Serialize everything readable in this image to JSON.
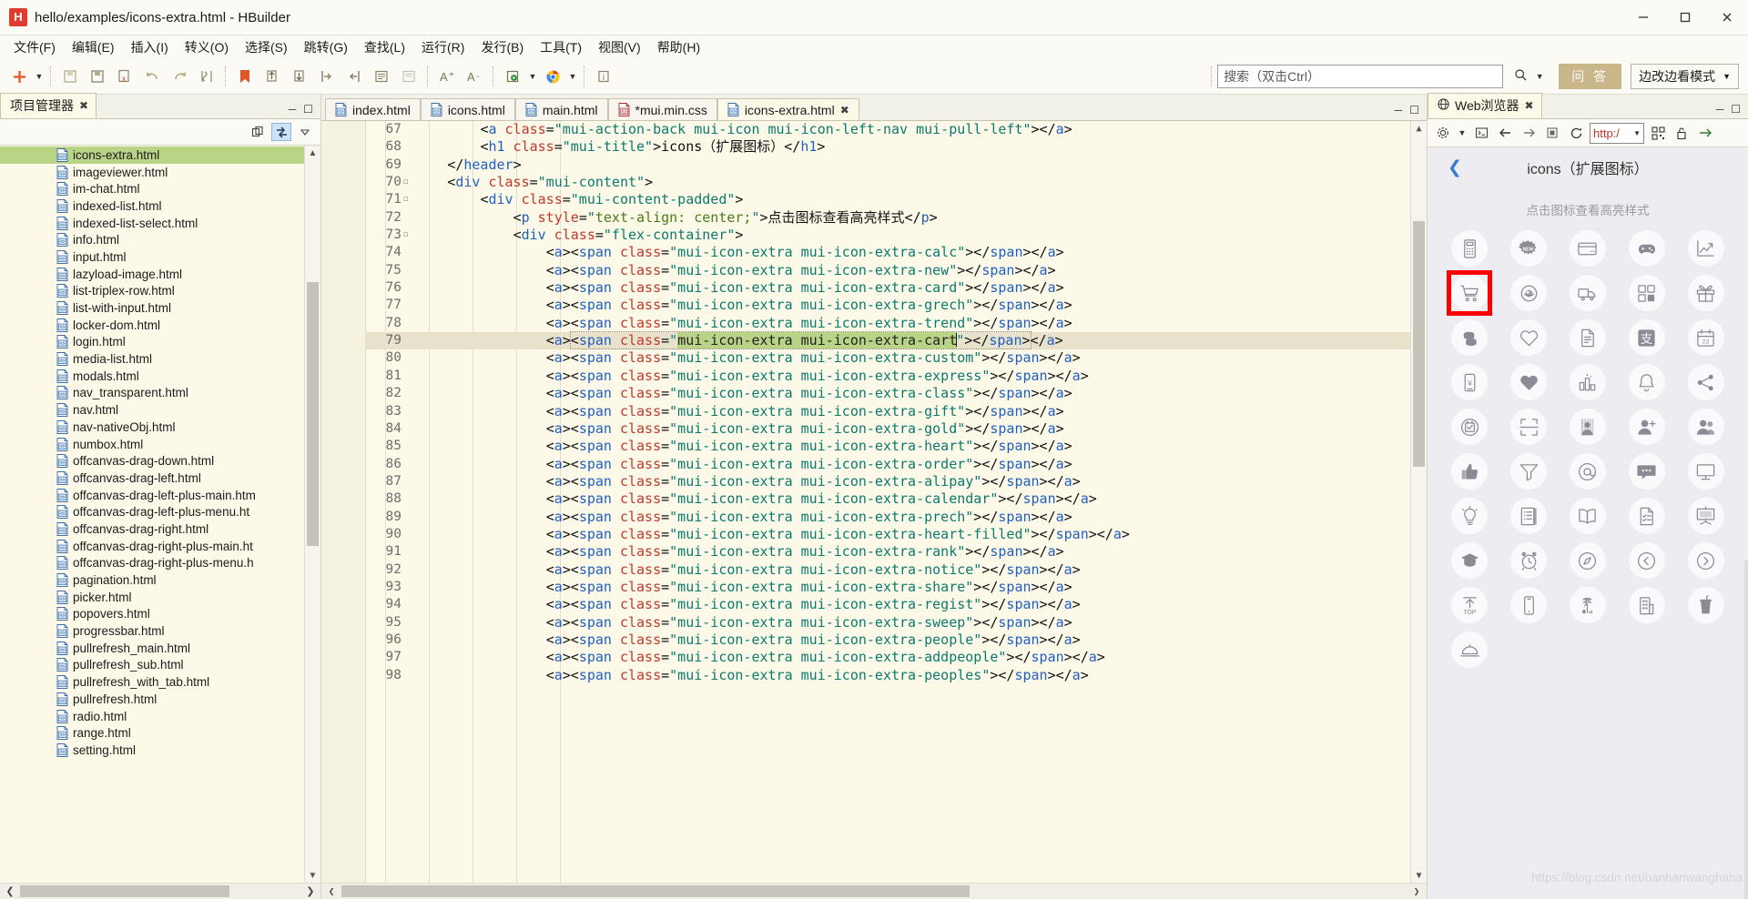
{
  "window": {
    "title": "hello/examples/icons-extra.html  -  HBuilder",
    "logo_text": "H",
    "minimize": "—",
    "maximize": "❐",
    "close": "✕"
  },
  "menubar": {
    "items": [
      {
        "label": "文件(F)",
        "name": "menu-file"
      },
      {
        "label": "编辑(E)",
        "name": "menu-edit"
      },
      {
        "label": "插入(I)",
        "name": "menu-insert"
      },
      {
        "label": "转义(O)",
        "name": "menu-escape"
      },
      {
        "label": "选择(S)",
        "name": "menu-select"
      },
      {
        "label": "跳转(G)",
        "name": "menu-goto"
      },
      {
        "label": "查找(L)",
        "name": "menu-find"
      },
      {
        "label": "运行(R)",
        "name": "menu-run"
      },
      {
        "label": "发行(B)",
        "name": "menu-publish"
      },
      {
        "label": "工具(T)",
        "name": "menu-tools"
      },
      {
        "label": "视图(V)",
        "name": "menu-view"
      },
      {
        "label": "帮助(H)",
        "name": "menu-help"
      }
    ]
  },
  "toolbar": {
    "search_placeholder": "搜索（双击Ctrl）",
    "search_value": "",
    "ask_label": "问 答",
    "mode_label": "边改边看模式"
  },
  "left_panel": {
    "tab_label": "项目管理器",
    "files": [
      {
        "name": "icons-extra.html",
        "selected": true
      },
      {
        "name": "imageviewer.html",
        "selected": false
      },
      {
        "name": "im-chat.html",
        "selected": false
      },
      {
        "name": "indexed-list.html",
        "selected": false
      },
      {
        "name": "indexed-list-select.html",
        "selected": false
      },
      {
        "name": "info.html",
        "selected": false
      },
      {
        "name": "input.html",
        "selected": false
      },
      {
        "name": "lazyload-image.html",
        "selected": false
      },
      {
        "name": "list-triplex-row.html",
        "selected": false
      },
      {
        "name": "list-with-input.html",
        "selected": false
      },
      {
        "name": "locker-dom.html",
        "selected": false
      },
      {
        "name": "login.html",
        "selected": false
      },
      {
        "name": "media-list.html",
        "selected": false
      },
      {
        "name": "modals.html",
        "selected": false
      },
      {
        "name": "nav_transparent.html",
        "selected": false
      },
      {
        "name": "nav.html",
        "selected": false
      },
      {
        "name": "nav-nativeObj.html",
        "selected": false
      },
      {
        "name": "numbox.html",
        "selected": false
      },
      {
        "name": "offcanvas-drag-down.html",
        "selected": false
      },
      {
        "name": "offcanvas-drag-left.html",
        "selected": false
      },
      {
        "name": "offcanvas-drag-left-plus-main.htm",
        "selected": false
      },
      {
        "name": "offcanvas-drag-left-plus-menu.ht",
        "selected": false
      },
      {
        "name": "offcanvas-drag-right.html",
        "selected": false
      },
      {
        "name": "offcanvas-drag-right-plus-main.ht",
        "selected": false
      },
      {
        "name": "offcanvas-drag-right-plus-menu.h",
        "selected": false
      },
      {
        "name": "pagination.html",
        "selected": false
      },
      {
        "name": "picker.html",
        "selected": false
      },
      {
        "name": "popovers.html",
        "selected": false
      },
      {
        "name": "progressbar.html",
        "selected": false
      },
      {
        "name": "pullrefresh_main.html",
        "selected": false
      },
      {
        "name": "pullrefresh_sub.html",
        "selected": false
      },
      {
        "name": "pullrefresh_with_tab.html",
        "selected": false
      },
      {
        "name": "pullrefresh.html",
        "selected": false
      },
      {
        "name": "radio.html",
        "selected": false
      },
      {
        "name": "range.html",
        "selected": false
      },
      {
        "name": "setting.html",
        "selected": false
      }
    ]
  },
  "editor": {
    "tabs": [
      {
        "label": "index.html",
        "active": false,
        "modified": false,
        "kind": "html"
      },
      {
        "label": "icons.html",
        "active": false,
        "modified": false,
        "kind": "html"
      },
      {
        "label": "main.html",
        "active": false,
        "modified": false,
        "kind": "html"
      },
      {
        "label": "*mui.min.css",
        "active": false,
        "modified": true,
        "kind": "css"
      },
      {
        "label": "icons-extra.html",
        "active": true,
        "modified": false,
        "kind": "html"
      }
    ],
    "first_line_number": 67,
    "current_line": 79,
    "selection_text": "mui-icon-extra mui-icon-extra-cart",
    "lines": [
      {
        "n": 67,
        "fold": false,
        "indent": 3,
        "segs": [
          {
            "t": "punc",
            "v": "<"
          },
          {
            "t": "tag",
            "v": "a"
          },
          {
            "t": "attr",
            "v": " class"
          },
          {
            "t": "punc",
            "v": "="
          },
          {
            "t": "str",
            "v": "\"mui-action-back mui-icon mui-icon-left-nav mui-pull-left\""
          },
          {
            "t": "punc",
            "v": ">"
          },
          {
            "t": "punc",
            "v": "</"
          },
          {
            "t": "tag",
            "v": "a"
          },
          {
            "t": "punc",
            "v": ">"
          }
        ]
      },
      {
        "n": 68,
        "fold": false,
        "indent": 3,
        "segs": [
          {
            "t": "punc",
            "v": "<"
          },
          {
            "t": "tag",
            "v": "h1"
          },
          {
            "t": "attr",
            "v": " class"
          },
          {
            "t": "punc",
            "v": "="
          },
          {
            "t": "str",
            "v": "\"mui-title\""
          },
          {
            "t": "punc",
            "v": ">"
          },
          {
            "t": "txt",
            "v": "icons（扩展图标）"
          },
          {
            "t": "punc",
            "v": "</"
          },
          {
            "t": "tag",
            "v": "h1"
          },
          {
            "t": "punc",
            "v": ">"
          }
        ]
      },
      {
        "n": 69,
        "fold": false,
        "indent": 2,
        "segs": [
          {
            "t": "punc",
            "v": "</"
          },
          {
            "t": "tag",
            "v": "header"
          },
          {
            "t": "punc",
            "v": ">"
          }
        ]
      },
      {
        "n": 70,
        "fold": true,
        "indent": 2,
        "segs": [
          {
            "t": "punc",
            "v": "<"
          },
          {
            "t": "tag",
            "v": "div"
          },
          {
            "t": "attr",
            "v": " class"
          },
          {
            "t": "punc",
            "v": "="
          },
          {
            "t": "str",
            "v": "\"mui-content\""
          },
          {
            "t": "punc",
            "v": ">"
          }
        ]
      },
      {
        "n": 71,
        "fold": true,
        "indent": 3,
        "segs": [
          {
            "t": "punc",
            "v": "<"
          },
          {
            "t": "tag",
            "v": "div"
          },
          {
            "t": "attr",
            "v": " class"
          },
          {
            "t": "punc",
            "v": "="
          },
          {
            "t": "str",
            "v": "\"mui-content-padded\""
          },
          {
            "t": "punc",
            "v": ">"
          }
        ]
      },
      {
        "n": 72,
        "fold": false,
        "indent": 4,
        "segs": [
          {
            "t": "punc",
            "v": "<"
          },
          {
            "t": "tag",
            "v": "p"
          },
          {
            "t": "attr",
            "v": " style"
          },
          {
            "t": "punc",
            "v": "="
          },
          {
            "t": "str",
            "v": "\""
          },
          {
            "t": "val",
            "v": "text-align: center;"
          },
          {
            "t": "str",
            "v": "\""
          },
          {
            "t": "punc",
            "v": ">"
          },
          {
            "t": "txt",
            "v": "点击图标查看高亮样式"
          },
          {
            "t": "punc",
            "v": "</"
          },
          {
            "t": "tag",
            "v": "p"
          },
          {
            "t": "punc",
            "v": ">"
          }
        ]
      },
      {
        "n": 73,
        "fold": true,
        "indent": 4,
        "segs": [
          {
            "t": "punc",
            "v": "<"
          },
          {
            "t": "tag",
            "v": "div"
          },
          {
            "t": "attr",
            "v": " class"
          },
          {
            "t": "punc",
            "v": "="
          },
          {
            "t": "str",
            "v": "\"flex-container\""
          },
          {
            "t": "punc",
            "v": ">"
          }
        ]
      },
      {
        "n": 74,
        "fold": false,
        "indent": 5,
        "icon": "calc"
      },
      {
        "n": 75,
        "fold": false,
        "indent": 5,
        "icon": "new"
      },
      {
        "n": 76,
        "fold": false,
        "indent": 5,
        "icon": "card"
      },
      {
        "n": 77,
        "fold": false,
        "indent": 5,
        "icon": "grech"
      },
      {
        "n": 78,
        "fold": false,
        "indent": 5,
        "icon": "trend"
      },
      {
        "n": 79,
        "fold": false,
        "indent": 5,
        "icon": "cart",
        "current": true
      },
      {
        "n": 80,
        "fold": false,
        "indent": 5,
        "icon": "custom"
      },
      {
        "n": 81,
        "fold": false,
        "indent": 5,
        "icon": "express"
      },
      {
        "n": 82,
        "fold": false,
        "indent": 5,
        "icon": "class"
      },
      {
        "n": 83,
        "fold": false,
        "indent": 5,
        "icon": "gift"
      },
      {
        "n": 84,
        "fold": false,
        "indent": 5,
        "icon": "gold"
      },
      {
        "n": 85,
        "fold": false,
        "indent": 5,
        "icon": "heart"
      },
      {
        "n": 86,
        "fold": false,
        "indent": 5,
        "icon": "order"
      },
      {
        "n": 87,
        "fold": false,
        "indent": 5,
        "icon": "alipay"
      },
      {
        "n": 88,
        "fold": false,
        "indent": 5,
        "icon": "calendar"
      },
      {
        "n": 89,
        "fold": false,
        "indent": 5,
        "icon": "prech"
      },
      {
        "n": 90,
        "fold": false,
        "indent": 5,
        "icon": "heart-filled"
      },
      {
        "n": 91,
        "fold": false,
        "indent": 5,
        "icon": "rank"
      },
      {
        "n": 92,
        "fold": false,
        "indent": 5,
        "icon": "notice"
      },
      {
        "n": 93,
        "fold": false,
        "indent": 5,
        "icon": "share"
      },
      {
        "n": 94,
        "fold": false,
        "indent": 5,
        "icon": "regist"
      },
      {
        "n": 95,
        "fold": false,
        "indent": 5,
        "icon": "sweep"
      },
      {
        "n": 96,
        "fold": false,
        "indent": 5,
        "icon": "people"
      },
      {
        "n": 97,
        "fold": false,
        "indent": 5,
        "icon": "addpeople"
      },
      {
        "n": 98,
        "fold": false,
        "indent": 5,
        "icon": "peoples"
      }
    ]
  },
  "right_panel": {
    "tab_label": "Web浏览器",
    "url_value": "http:/",
    "page_title": "icons（扩展图标）",
    "page_hint": "点击图标查看高亮样式",
    "highlight_color": "#ff0000",
    "highlighted_icon": "cart",
    "watermark": "https://blog.csdn.net/hanhanwanghaha",
    "icons": [
      "calc",
      "new",
      "card",
      "game",
      "trend",
      "cart",
      "custom",
      "express",
      "class",
      "gift",
      "gold",
      "heart",
      "order",
      "alipay",
      "calendar",
      "prech",
      "heart-filled",
      "rank",
      "notice",
      "share",
      "regist",
      "sweep",
      "people",
      "addpeople",
      "peoples",
      "like",
      "filter",
      "at",
      "comment",
      "monitor",
      "idea",
      "book",
      "read",
      "check-list",
      "board",
      "edu",
      "alarm",
      "compass",
      "back-circle",
      "forward-circle",
      "top",
      "phone",
      "travel",
      "building",
      "drink",
      "food"
    ]
  }
}
